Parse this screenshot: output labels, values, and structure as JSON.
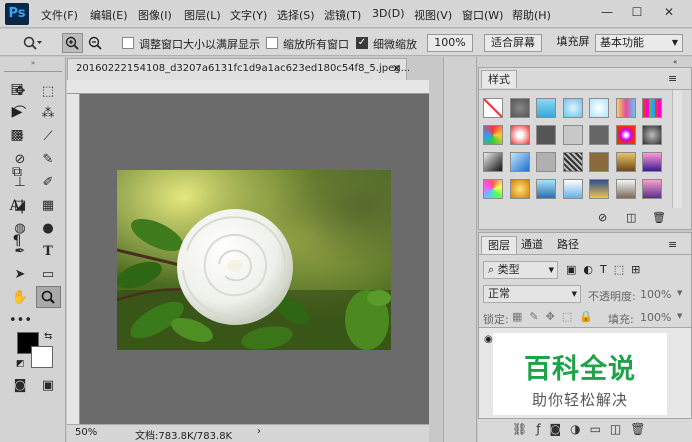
{
  "menubar": {
    "logo": "Ps",
    "items": [
      "文件(F)",
      "编辑(E)",
      "图像(I)",
      "图层(L)",
      "文字(Y)",
      "选择(S)",
      "滤镜(T)",
      "3D(D)",
      "视图(V)",
      "窗口(W)",
      "帮助(H)"
    ],
    "window_buttons": [
      "—",
      "☐",
      "✕"
    ]
  },
  "options": {
    "cb1_label": "调整窗口大小以满屏显示",
    "cb2_label": "缩放所有窗口",
    "cb3_label": "细微缩放",
    "zoom_value": "100%",
    "fit_label": "适合屏幕",
    "fill_label": "填充屏",
    "workspace": "基本功能"
  },
  "document": {
    "tab_title": "20160222154108_d3207a6131fc1d9a1ac623ed180c54f8_5.jpeg...",
    "zoom": "50%",
    "doc_info": "文档:783.8K/783.8K"
  },
  "styles_panel": {
    "title": "样式"
  },
  "layers_panel": {
    "tabs": [
      "图层",
      "通道",
      "路径"
    ],
    "kind_label": "类型",
    "blend_mode": "正常",
    "opacity_label": "不透明度:",
    "opacity_value": "100%",
    "lock_label": "锁定:",
    "fill_label": "填充:",
    "fill_value": "100%"
  },
  "watermark": {
    "title": "百科全说",
    "subtitle": "助你轻松解决"
  },
  "colors": {
    "accent": "#31a8ff",
    "watermark_green": "#1fa34a"
  }
}
